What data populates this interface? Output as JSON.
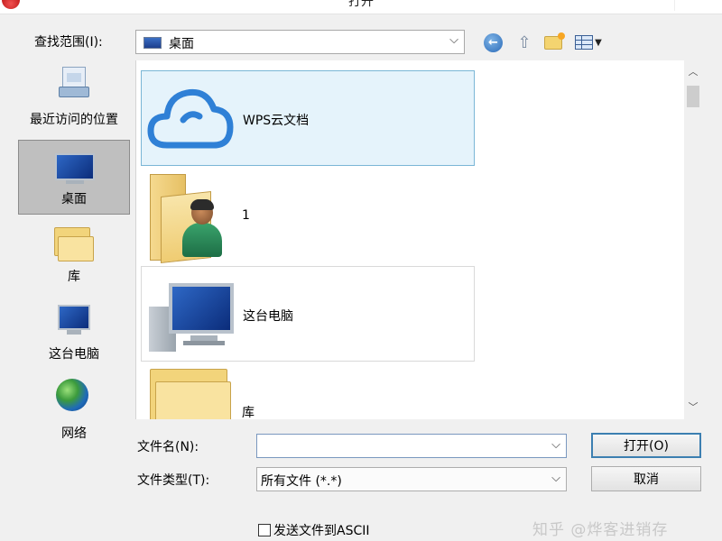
{
  "window": {
    "title": "打开"
  },
  "lookin": {
    "label": "查找范围(I):",
    "value": "桌面"
  },
  "toolbar": {
    "back_icon": "back-arrow-icon",
    "up_icon": "up-folder-icon",
    "new_folder_icon": "new-folder-icon",
    "view_menu_icon": "view-menu-icon"
  },
  "places": [
    {
      "label": "最近访问的位置",
      "icon": "recent-places-icon",
      "selected": false
    },
    {
      "label": "桌面",
      "icon": "desktop-icon",
      "selected": true
    },
    {
      "label": "库",
      "icon": "libraries-icon",
      "selected": false
    },
    {
      "label": "这台电脑",
      "icon": "computer-icon",
      "selected": false
    },
    {
      "label": "网络",
      "icon": "network-icon",
      "selected": false
    }
  ],
  "files": [
    {
      "name": "WPS云文档",
      "icon": "cloud-icon",
      "state": "selected"
    },
    {
      "name": "1",
      "icon": "user-folder-icon",
      "state": "normal"
    },
    {
      "name": "这台电脑",
      "icon": "computer-icon",
      "state": "hovered"
    },
    {
      "name": "库",
      "icon": "libraries-icon",
      "state": "normal"
    }
  ],
  "form": {
    "filename_label": "文件名(N):",
    "filename_value": "",
    "filetype_label": "文件类型(T):",
    "filetype_value": "所有文件 (*.*)"
  },
  "buttons": {
    "open": "打开(O)",
    "cancel": "取消"
  },
  "checkbox": {
    "label": "发送文件到ASCII",
    "checked": false
  },
  "watermark": "知乎 @烨客进销存",
  "colors": {
    "accent": "#3c7fb1",
    "selection_bg": "#e5f3fb",
    "selection_border": "#7ab6d6",
    "cloud": "#2f80d6"
  }
}
